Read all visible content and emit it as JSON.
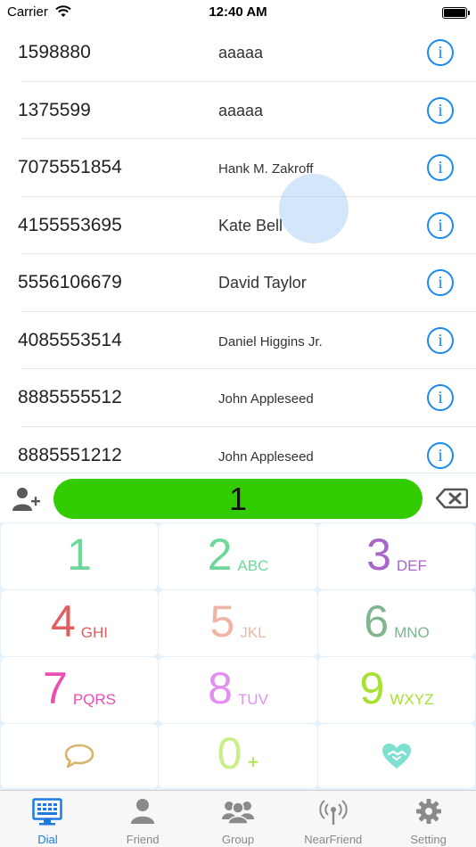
{
  "status_bar": {
    "carrier": "Carrier",
    "time": "12:40 AM"
  },
  "contacts": [
    {
      "number": "1598880",
      "name": "aaaaa",
      "size": "large"
    },
    {
      "number": "1375599",
      "name": "aaaaa",
      "size": "large"
    },
    {
      "number": "7075551854",
      "name": "Hank M. Zakroff",
      "size": "small"
    },
    {
      "number": "4155553695",
      "name": "Kate Bell",
      "size": "large"
    },
    {
      "number": "5556106679",
      "name": "David Taylor",
      "size": "large"
    },
    {
      "number": "4085553514",
      "name": "Daniel Higgins Jr.",
      "size": "small"
    },
    {
      "number": "8885555512",
      "name": "John Appleseed",
      "size": "small"
    },
    {
      "number": "8885551212",
      "name": "John Appleseed",
      "size": "small"
    }
  ],
  "info_glyph": "i",
  "dial": {
    "entered": "1"
  },
  "keypad": [
    {
      "digit": "1",
      "letters": ""
    },
    {
      "digit": "2",
      "letters": "ABC"
    },
    {
      "digit": "3",
      "letters": "DEF"
    },
    {
      "digit": "4",
      "letters": "GHI"
    },
    {
      "digit": "5",
      "letters": "JKL"
    },
    {
      "digit": "6",
      "letters": "MNO"
    },
    {
      "digit": "7",
      "letters": "PQRS"
    },
    {
      "digit": "8",
      "letters": "TUV"
    },
    {
      "digit": "9",
      "letters": "WXYZ"
    },
    {
      "digit": "0",
      "letters": "+"
    }
  ],
  "tabs": [
    {
      "label": "Dial",
      "icon": "dial-icon",
      "active": true
    },
    {
      "label": "Friend",
      "icon": "friend-icon",
      "active": false
    },
    {
      "label": "Group",
      "icon": "group-icon",
      "active": false
    },
    {
      "label": "NearFriend",
      "icon": "antenna-icon",
      "active": false
    },
    {
      "label": "Setting",
      "icon": "gear-icon",
      "active": false
    }
  ],
  "colors": {
    "accent": "#1b8af0",
    "dial_display": "#33cc00",
    "keypad_background": "#e4f0fa"
  }
}
